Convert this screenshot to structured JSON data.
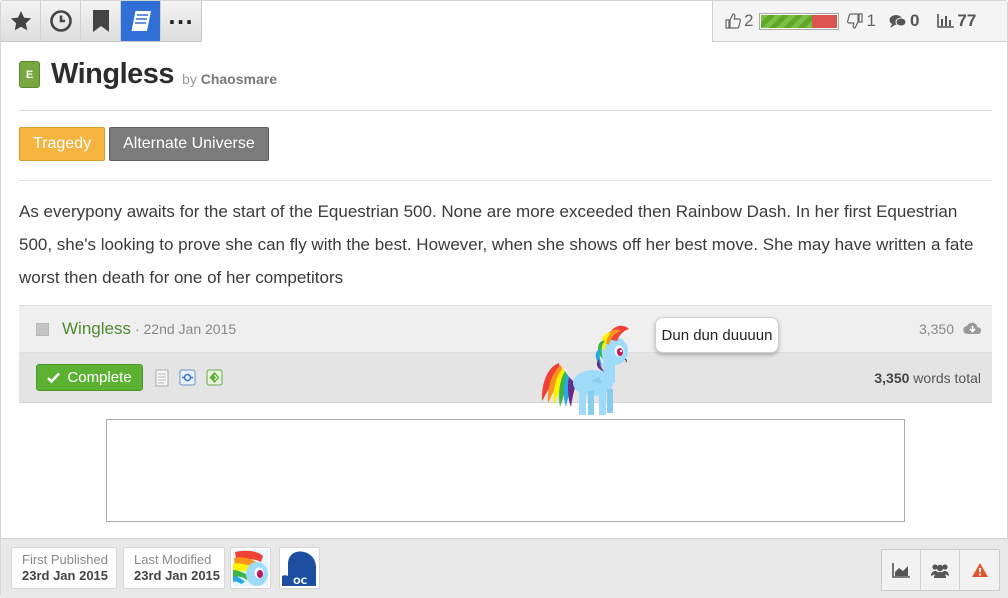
{
  "toolbar": {
    "tabs": [
      {
        "icon": "star-icon"
      },
      {
        "icon": "clock-icon"
      },
      {
        "icon": "bookmark-icon"
      },
      {
        "icon": "book-icon",
        "active": true
      },
      {
        "icon": "more-icon",
        "label": "..."
      }
    ]
  },
  "stats": {
    "likes": "2",
    "dislikes": "1",
    "comments": "0",
    "views": "77",
    "rating_like_fraction": 0.67
  },
  "story": {
    "rating_badge": "E",
    "title": "Wingless",
    "by": "by",
    "author": "Chaosmare",
    "tags": [
      "Tragedy",
      "Alternate Universe"
    ],
    "description": "As everypony awaits for the start of the Equestrian 500. None are more exceeded then Rainbow Dash. In her first Equestrian 500, she's looking to prove she can fly with the best. However, when she shows off her best move. She may have written a fate worst then death for one of her competitors"
  },
  "chapters": [
    {
      "title": "Wingless",
      "date": "· 22nd Jan 2015",
      "words": "3,350"
    }
  ],
  "status": {
    "complete_label": "Complete",
    "total_words_number": "3,350",
    "total_words_suffix": " words total"
  },
  "tooltip": "Dun dun duuuun",
  "bottom": {
    "first_published_label": "First Published",
    "first_published_value": "23rd Jan 2015",
    "last_modified_label": "Last Modified",
    "last_modified_value": "23rd Jan 2015",
    "characters": [
      {
        "icon": "rainbow-dash-avatar"
      },
      {
        "icon": "oc-avatar",
        "label": "OC"
      }
    ]
  },
  "colors": {
    "accent_blue": "#2f6fd6",
    "complete_green": "#5cb032",
    "tragedy_orange": "#f5b33f",
    "au_gray": "#7b7b7b",
    "chapter_link": "#4f8a2d"
  }
}
